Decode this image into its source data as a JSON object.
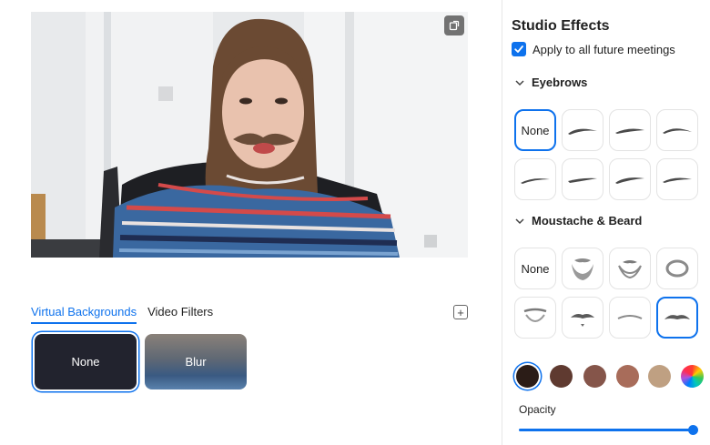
{
  "virtual_backgrounds_tab": "Virtual Backgrounds",
  "video_filters_tab": "Video Filters",
  "backgrounds": [
    {
      "label": "None",
      "selected": true
    },
    {
      "label": "Blur",
      "selected": false
    }
  ],
  "studio_effects": {
    "title": "Studio Effects",
    "apply_all_label": "Apply to all future meetings",
    "apply_all_checked": true,
    "eyebrows": {
      "title": "Eyebrows",
      "none_label": "None",
      "selected_index": 0
    },
    "moustache": {
      "title": "Moustache & Beard",
      "none_label": "None",
      "selected_index": 7
    },
    "colors": [
      "#2b1c17",
      "#5f3a30",
      "#85554a",
      "#a86c5a",
      "#bfa082",
      "rainbow"
    ],
    "selected_color_index": 0,
    "opacity_label": "Opacity",
    "opacity_value": 1.0
  },
  "icons": {
    "rotate": "rotate-icon",
    "add": "plus-icon",
    "check": "check-icon",
    "chevron": "chevron-down-icon"
  }
}
